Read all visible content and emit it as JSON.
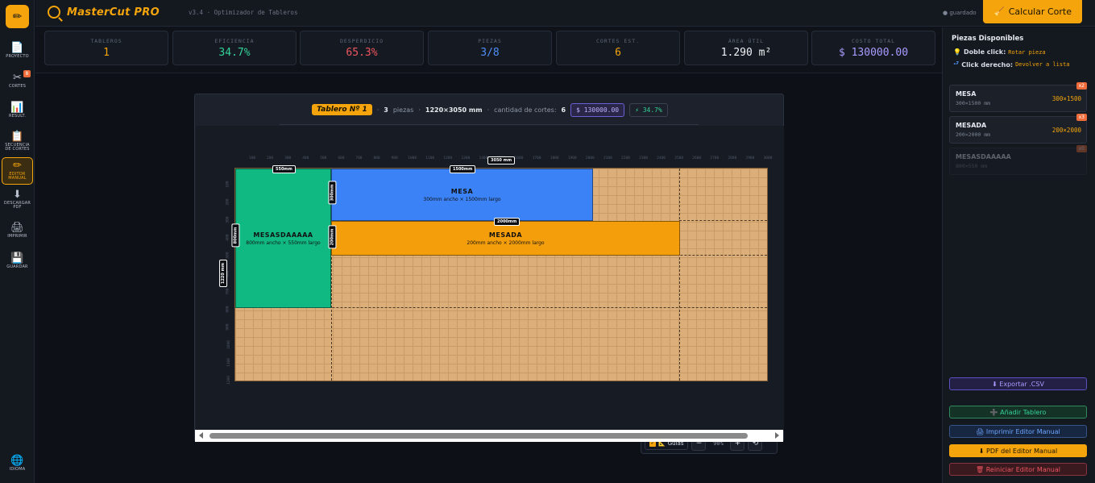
{
  "app": {
    "title": "MasterCut PRO",
    "version": "v3.4 · Optimizador de Tableros",
    "saved": "● guardado",
    "calc_button": "Calcular Corte"
  },
  "rail": {
    "items": [
      {
        "label": "PROYECTO",
        "icon": "📄"
      },
      {
        "label": "CORTES",
        "icon": "✂",
        "badge": "8"
      },
      {
        "label": "RESULT.",
        "icon": "📊"
      },
      {
        "label": "SECUENCIA DE CORTES",
        "icon": "📋"
      },
      {
        "label": "EDITOR MANUAL",
        "icon": "✏"
      },
      {
        "label": "DESCARGAR PDF",
        "icon": "⬇"
      },
      {
        "label": "IMPRIMIR",
        "icon": "🖨"
      },
      {
        "label": "GUARDAR",
        "icon": "💾"
      },
      {
        "label": "IDIOMA",
        "icon": "🌐"
      }
    ]
  },
  "stats": [
    {
      "label": "TABLEROS",
      "value": "1",
      "color": "#f5a50b"
    },
    {
      "label": "EFICIENCIA",
      "value": "34.7%",
      "color": "#34d399"
    },
    {
      "label": "DESPERDICIO",
      "value": "65.3%",
      "color": "#f0555f"
    },
    {
      "label": "PIEZAS",
      "value": "3/8",
      "color": "#4f8ff7"
    },
    {
      "label": "CORTES EST.",
      "value": "6",
      "color": "#f5a50b"
    },
    {
      "label": "ÁREA ÚTIL",
      "value": "1.290 m²",
      "color": "#f1f3f6"
    },
    {
      "label": "COSTO TOTAL",
      "value": "$ 130000.00",
      "color": "#a99bff"
    }
  ],
  "board_head": {
    "tag": "Tablero Nº 1",
    "count": "3",
    "count_label": "piezas",
    "size": "1220×3050 mm",
    "cuts_label": "cantidad de cortes:",
    "cuts": "6",
    "cost": "$ 130000.00",
    "eff": "⚡ 34.7%"
  },
  "rulers": {
    "top": [
      "100",
      "200",
      "300",
      "400",
      "500",
      "600",
      "700",
      "800",
      "900",
      "1000",
      "1100",
      "1200",
      "1300",
      "1400",
      "1500",
      "1600",
      "1700",
      "1800",
      "1900",
      "2000",
      "2100",
      "2200",
      "2300",
      "2400",
      "2500",
      "2600",
      "2700",
      "2800",
      "2900",
      "3000"
    ],
    "left": [
      "100",
      "200",
      "300",
      "400",
      "500",
      "600",
      "700",
      "800",
      "900",
      "1000",
      "1100",
      "1200"
    ]
  },
  "dims": {
    "board_w": "3050 mm",
    "board_h": "1220 mm",
    "p1_w": "550mm",
    "p1_h": "800mm",
    "p2_w": "1500mm",
    "p2_h": "300mm",
    "p3_w": "2000mm",
    "p3_h": "200mm"
  },
  "pieces": [
    {
      "name": "MESASDAAAAA",
      "desc": "800mm ancho × 550mm largo",
      "color": "#10b981"
    },
    {
      "name": "MESA",
      "desc": "300mm ancho × 1500mm largo",
      "color": "#3b82f6"
    },
    {
      "name": "MESADA",
      "desc": "200mm ancho × 2000mm largo",
      "color": "#f59e0b"
    }
  ],
  "zoom": {
    "guides": "Guías",
    "minus": "−",
    "value": "90%",
    "plus": "+",
    "reset": "⟲"
  },
  "right_panel": {
    "title": "Piezas Disponibles",
    "hint1_key": "Doble click:",
    "hint1_val": "Rotar pieza",
    "hint2_key": "Click derecho:",
    "hint2_val": "Devolver a lista",
    "list": [
      {
        "name": "MESA",
        "dims": "300×1500 mm",
        "size": "300×1500",
        "qty": "x2"
      },
      {
        "name": "MESADA",
        "dims": "200×2000 mm",
        "size": "200×2000",
        "qty": "x3"
      },
      {
        "name": "MESASDAAAAA",
        "dims": "800×550 mm",
        "size": "",
        "qty": "x0"
      }
    ],
    "buttons": {
      "export": "⬇ Exportar .CSV",
      "add": "➕ Añadir Tablero",
      "print": "🖨 Imprimir Editor Manual",
      "pdf": "⬇ PDF del Editor Manual",
      "reset": "🗑 Reiniciar Editor Manual"
    }
  }
}
